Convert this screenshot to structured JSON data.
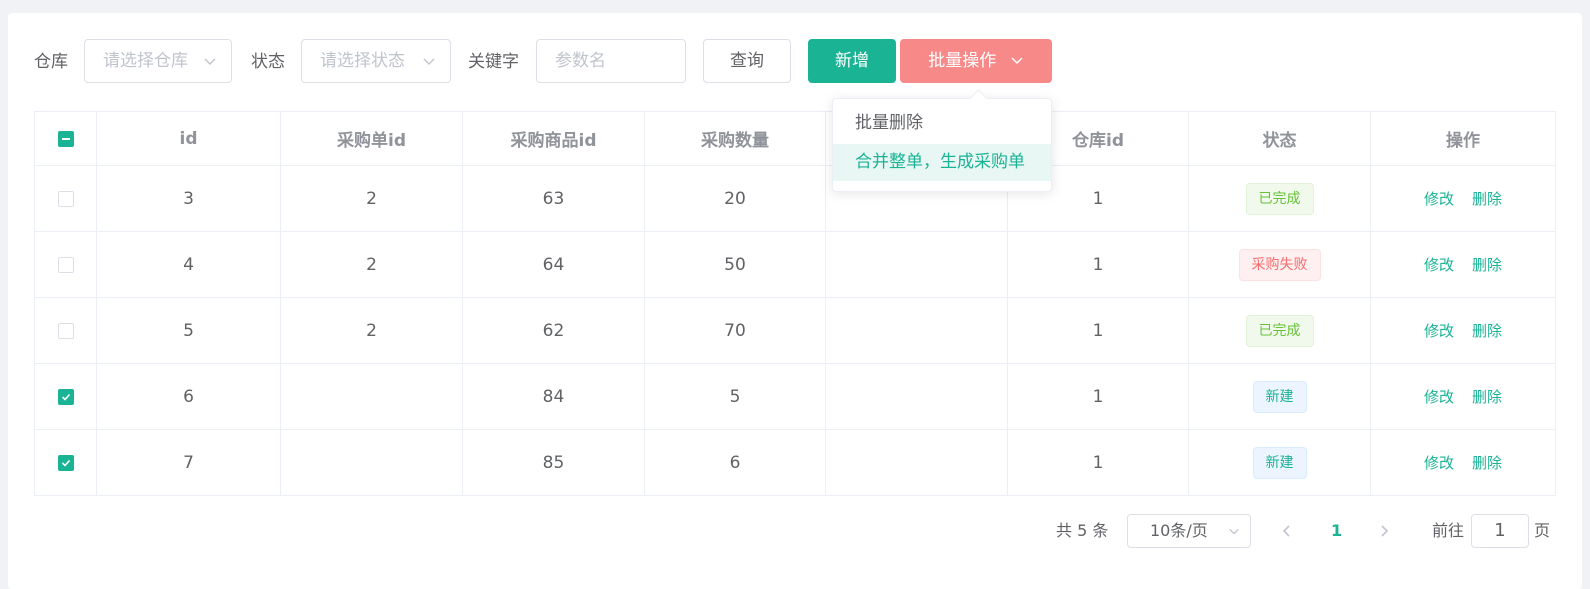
{
  "toolbar": {
    "warehouse_label": "仓库",
    "warehouse_placeholder": "请选择仓库",
    "status_label": "状态",
    "status_placeholder": "请选择状态",
    "keyword_label": "关键字",
    "keyword_placeholder": "参数名",
    "query_button": "查询",
    "add_button": "新增",
    "batch_button": "批量操作"
  },
  "batch_menu": {
    "items": [
      "批量删除",
      "合并整单，生成采购单"
    ],
    "active_index": 1
  },
  "table": {
    "columns": [
      "id",
      "采购单id",
      "采购商品id",
      "采购数量",
      "",
      "仓库id",
      "状态",
      "操作"
    ],
    "header_checkbox": "indeterminate",
    "rows": [
      {
        "checked": false,
        "id": "3",
        "purchase_id": "2",
        "sku_id": "63",
        "qty": "20",
        "col5": "",
        "ware_id": "1",
        "status": "已完成",
        "status_type": "success"
      },
      {
        "checked": false,
        "id": "4",
        "purchase_id": "2",
        "sku_id": "64",
        "qty": "50",
        "col5": "",
        "ware_id": "1",
        "status": "采购失败",
        "status_type": "danger"
      },
      {
        "checked": false,
        "id": "5",
        "purchase_id": "2",
        "sku_id": "62",
        "qty": "70",
        "col5": "",
        "ware_id": "1",
        "status": "已完成",
        "status_type": "success"
      },
      {
        "checked": true,
        "id": "6",
        "purchase_id": "",
        "sku_id": "84",
        "qty": "5",
        "col5": "",
        "ware_id": "1",
        "status": "新建",
        "status_type": "info"
      },
      {
        "checked": true,
        "id": "7",
        "purchase_id": "",
        "sku_id": "85",
        "qty": "6",
        "col5": "",
        "ware_id": "1",
        "status": "新建",
        "status_type": "info"
      }
    ],
    "edit_label": "修改",
    "delete_label": "删除"
  },
  "pagination": {
    "total_text": "共 5 条",
    "page_size": "10条/页",
    "current_page": "1",
    "goto_label": "前往",
    "goto_value": "1",
    "page_suffix": "页"
  },
  "colors": {
    "accent": "#1ab394",
    "danger_button": "#f78989"
  }
}
